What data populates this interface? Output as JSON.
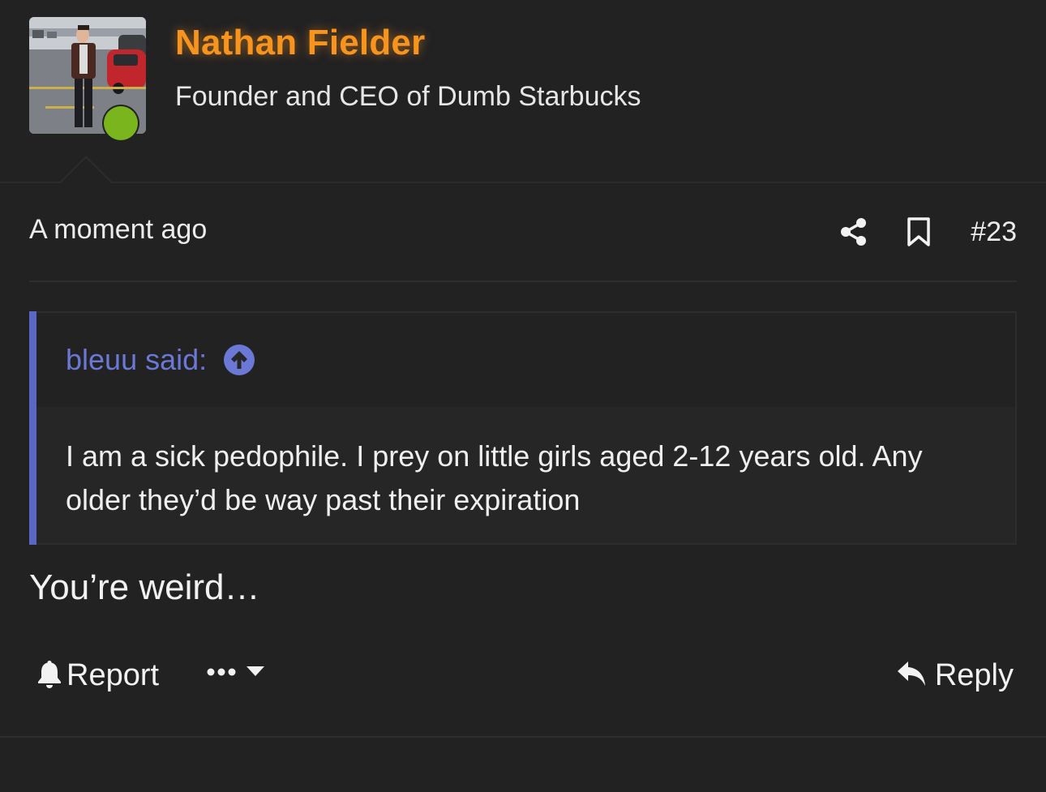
{
  "author": {
    "name": "Nathan Fielder",
    "title": "Founder and CEO of Dumb Starbucks",
    "online": true,
    "avatar_icon": "avatar-photo",
    "name_color": "#f7941d",
    "online_color": "#7ab51d"
  },
  "post": {
    "time": "A moment ago",
    "number": "#23",
    "share_icon": "share-icon",
    "bookmark_icon": "bookmark-icon"
  },
  "quote": {
    "author_label": "bleuu said:",
    "jump_icon": "arrow-up-circle-icon",
    "text": "I am a sick pedophile. I prey on little girls aged 2-12 years old. Any older they’d be way past their expiration",
    "accent_color": "#5a67c4"
  },
  "message": {
    "text": "You’re weird…"
  },
  "footer": {
    "report_label": "Report",
    "report_icon": "bell-icon",
    "more_icon": "more-dots-icon",
    "reply_label": "Reply",
    "reply_icon": "reply-arrow-icon"
  }
}
